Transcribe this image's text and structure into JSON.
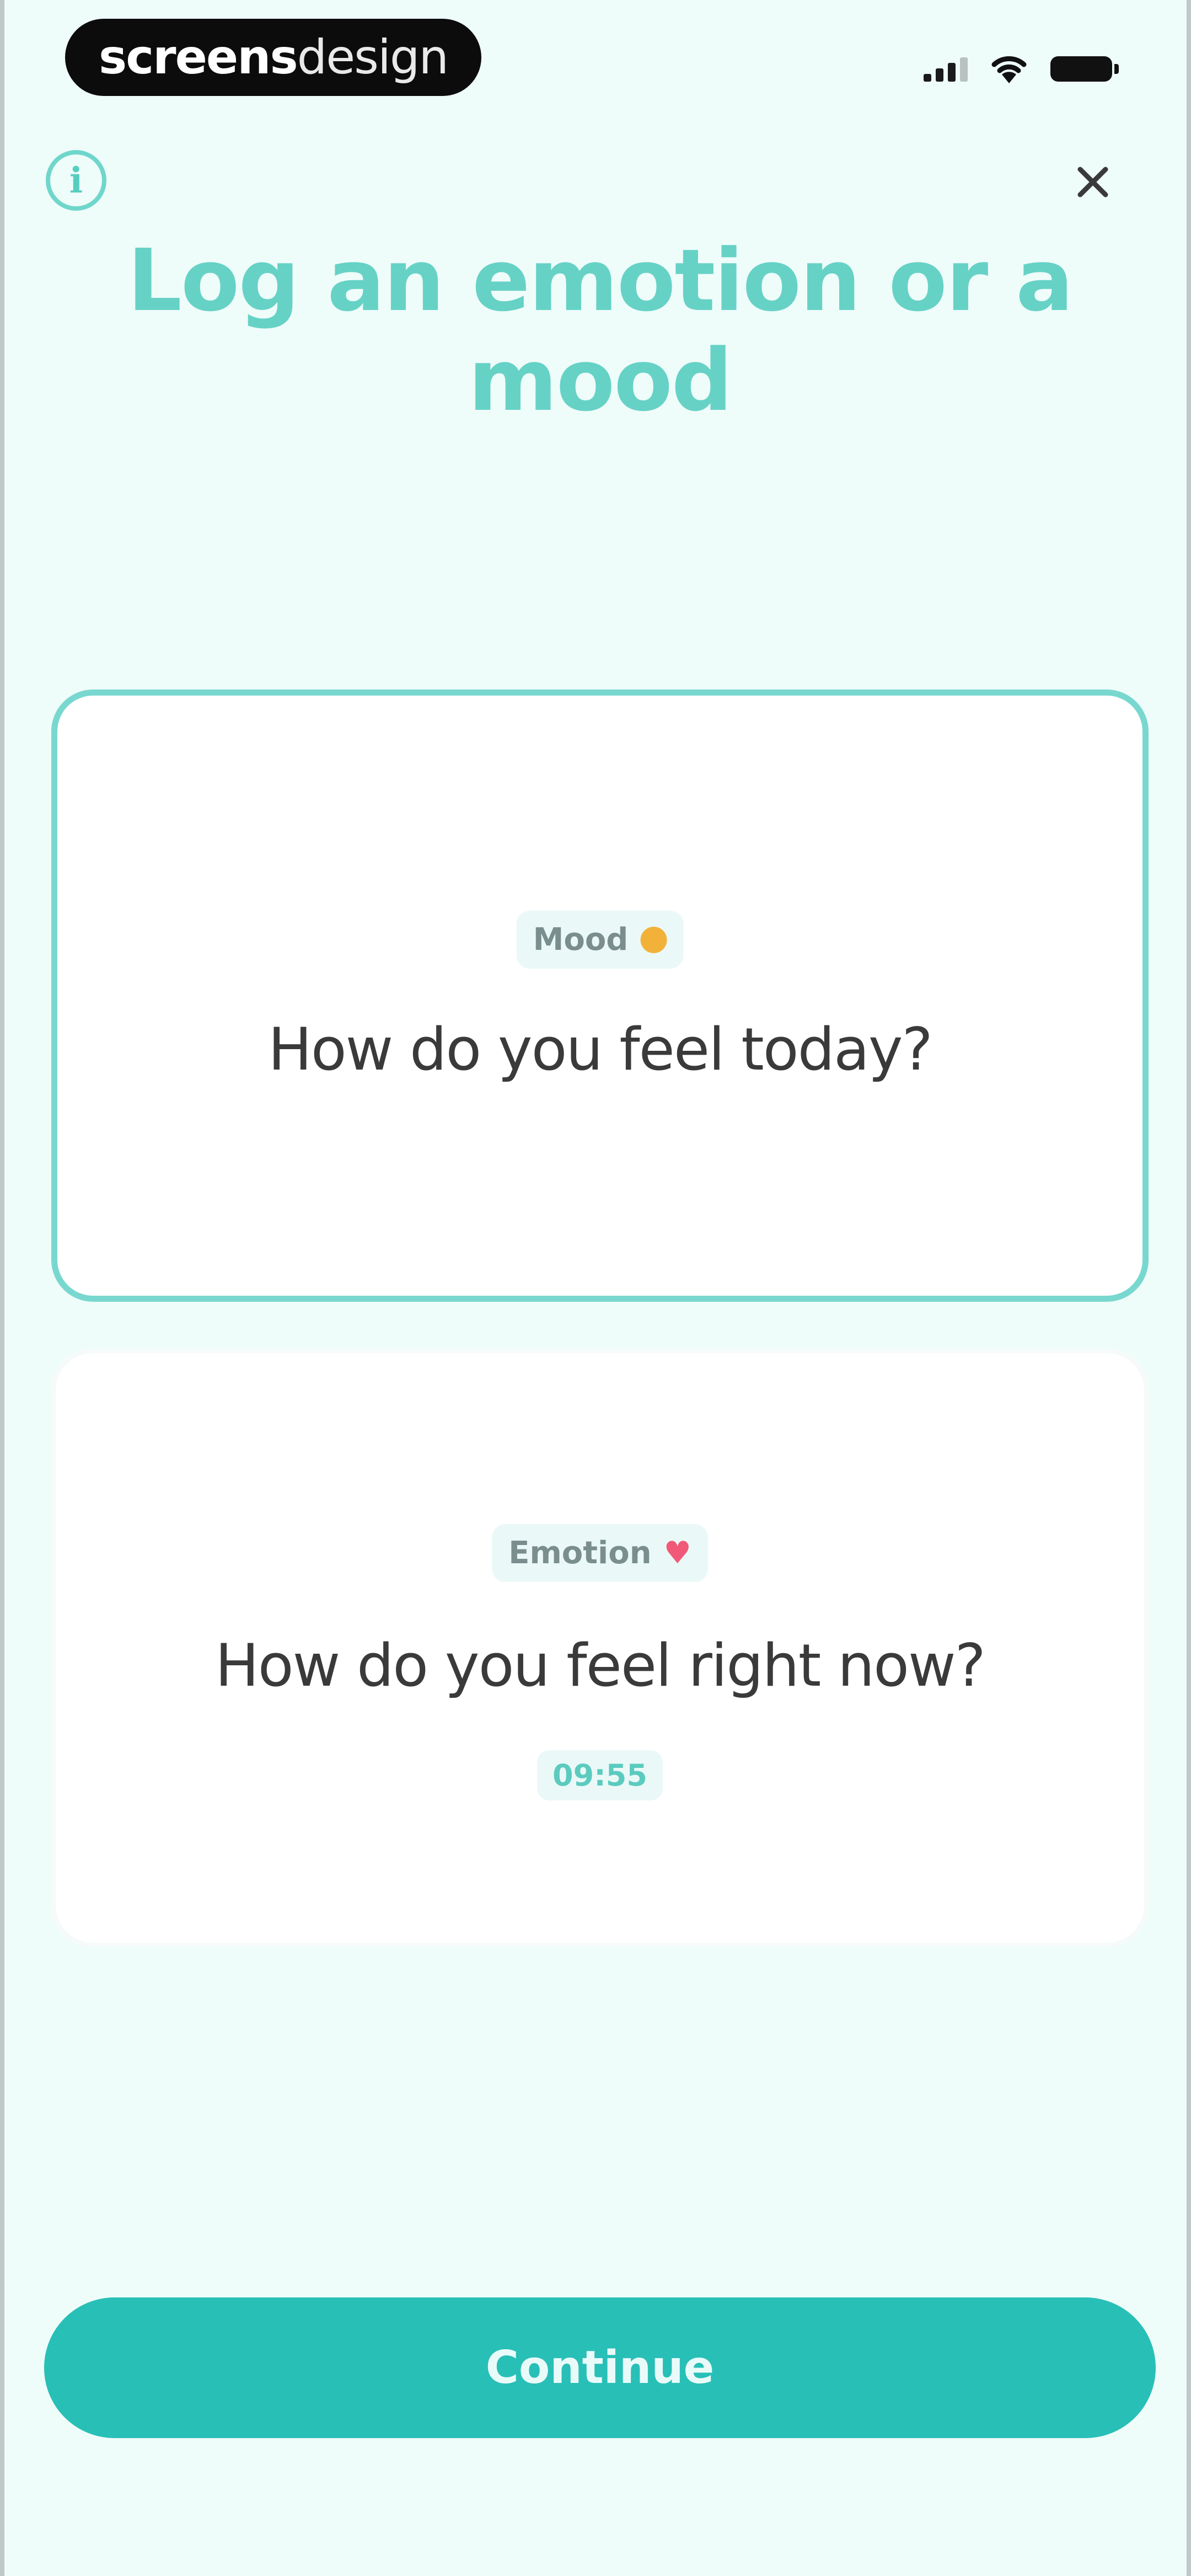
{
  "status_bar": {
    "brand_bold": "screens",
    "brand_light": "design",
    "icons": [
      "signal-icon",
      "wifi-icon",
      "battery-icon"
    ]
  },
  "header": {
    "info_icon": "info-icon",
    "close_icon": "close-icon",
    "title": "Log an emotion or a mood"
  },
  "cards": {
    "mood": {
      "label": "Mood",
      "icon": "sun-icon",
      "question": "How do you feel today?",
      "selected": true
    },
    "emotion": {
      "label": "Emotion",
      "icon": "heart-icon",
      "question": "How do you feel right now?",
      "time": "09:55"
    }
  },
  "footer": {
    "continue_label": "Continue"
  },
  "colors": {
    "accent": "#28bfb7",
    "title": "#66d2c6",
    "background": "#eefcfa",
    "mood_dot": "#f2b23a",
    "heart": "#f05a78"
  }
}
